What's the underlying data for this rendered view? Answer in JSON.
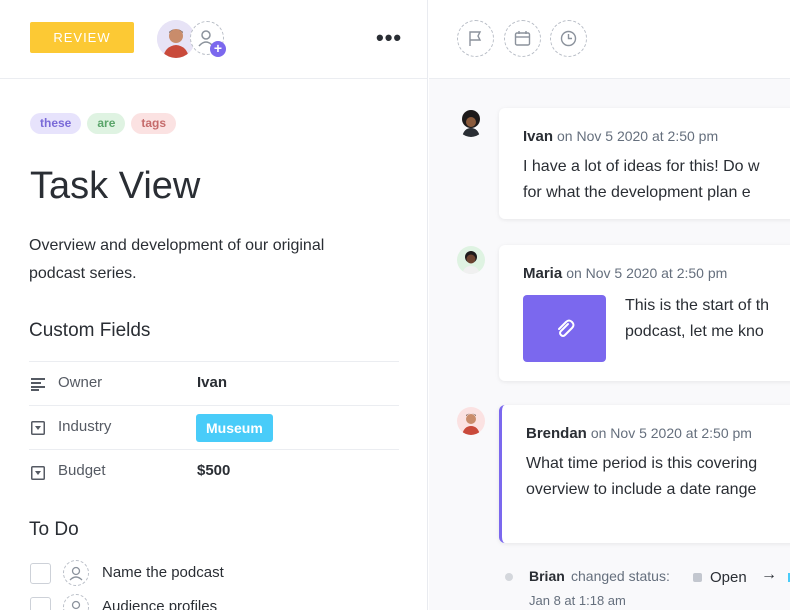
{
  "header": {
    "status_label": "REVIEW",
    "status_color": "#fcc934",
    "more_label": "•••"
  },
  "tags": [
    "these",
    "are",
    "tags"
  ],
  "task": {
    "title": "Task View",
    "description": "Overview and development of our original podcast series."
  },
  "custom_fields": {
    "heading": "Custom Fields",
    "rows": [
      {
        "name": "Owner",
        "value": "Ivan"
      },
      {
        "name": "Industry",
        "value": "Museum"
      },
      {
        "name": "Budget",
        "value": "$500"
      }
    ]
  },
  "todo": {
    "heading": "To Do",
    "items": [
      "Name the podcast",
      "Audience profiles"
    ]
  },
  "comments": [
    {
      "author": "Ivan",
      "meta": "on Nov 5 2020 at 2:50 pm",
      "lines": [
        "I have a lot of ideas for this! Do w",
        "for what the development plan e"
      ]
    },
    {
      "author": "Maria",
      "meta": "on Nov 5 2020 at 2:50 pm",
      "lines": [
        "This is the start of th",
        "podcast, let me kno"
      ]
    },
    {
      "author": "Brendan",
      "meta": "on Nov 5 2020 at 2:50 pm",
      "lines": [
        "What time period is this covering",
        "overview to include a date range"
      ]
    }
  ],
  "activity": {
    "who": "Brian",
    "what": "changed status:",
    "status": "Open",
    "arrow": "→",
    "when": "Jan 8 at 1:18 am"
  },
  "colors": {
    "accent": "#7b68ee",
    "industry_badge": "#49ccf9"
  }
}
